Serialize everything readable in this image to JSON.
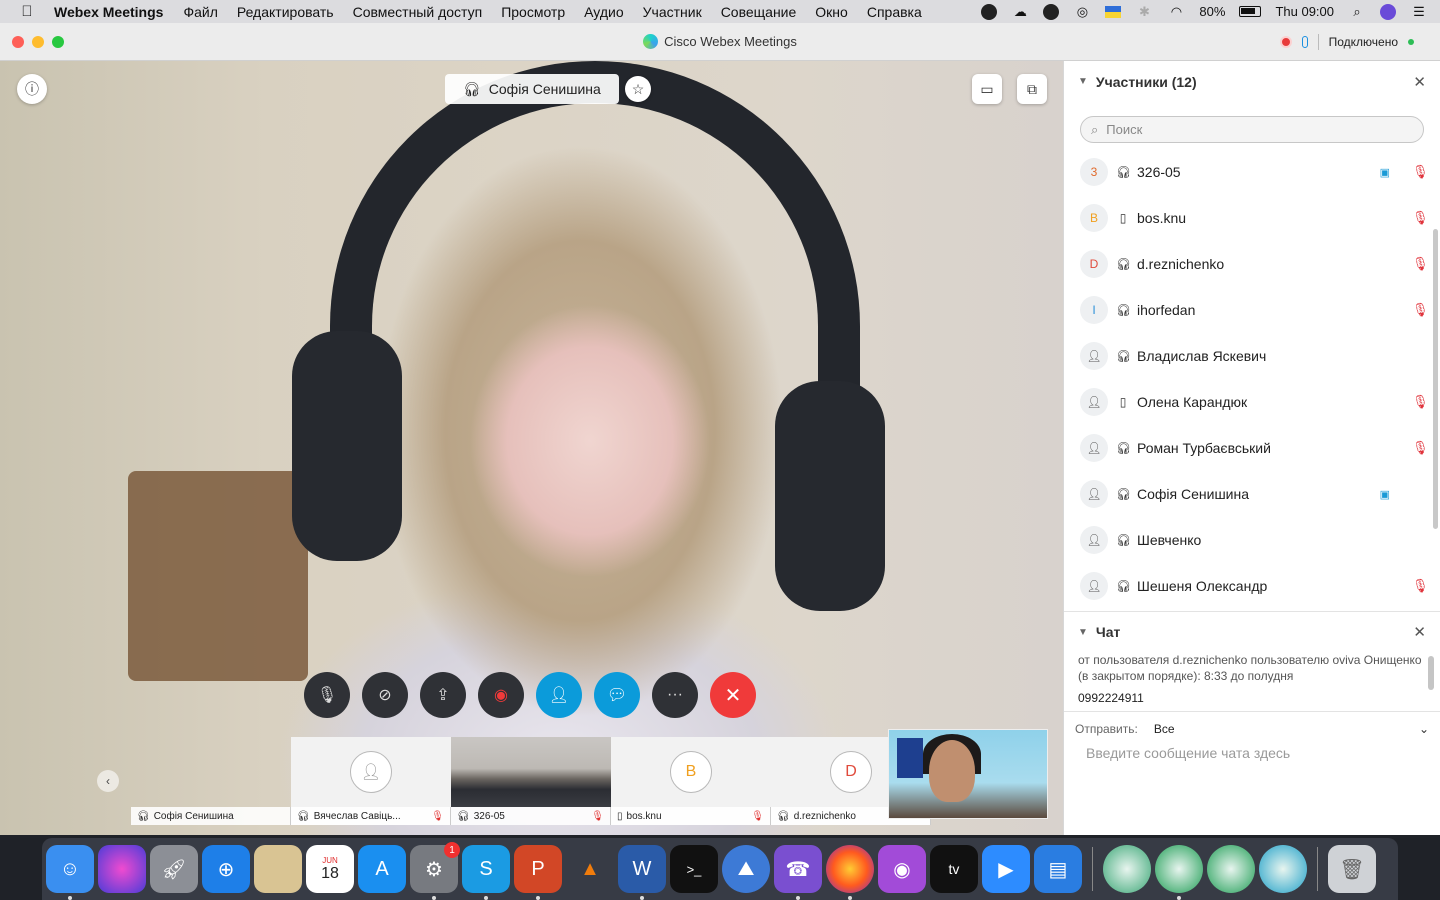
{
  "menubar": {
    "app_name": "Webex Meetings",
    "items": [
      "Файл",
      "Редактировать",
      "Совместный доступ",
      "Просмотр",
      "Аудио",
      "Участник",
      "Совещание",
      "Окно",
      "Справка"
    ],
    "battery": "80%",
    "clock": "Thu 09:00"
  },
  "window": {
    "title": "Cisco Webex Meetings",
    "status": "Подключено"
  },
  "stage": {
    "active_speaker": "Софія Сенишина"
  },
  "thumbnails": [
    {
      "name": "Софія Сенишина",
      "type": "video-live",
      "muted": false
    },
    {
      "name": "Вячеслав Савіць...",
      "type": "avatar",
      "initial": "",
      "muted": true
    },
    {
      "name": "326-05",
      "type": "video-room",
      "muted": true
    },
    {
      "name": "bos.knu",
      "type": "avatar",
      "initial": "B",
      "muted": true
    },
    {
      "name": "d.reznichenko",
      "type": "avatar",
      "initial": "D",
      "muted": false
    }
  ],
  "participants": {
    "header": "Участники (12)",
    "search_placeholder": "Поиск",
    "list": [
      {
        "initial": "3",
        "initial_color": "#e06a2c",
        "audio": "headset",
        "name": "326-05",
        "video": true,
        "muted": true
      },
      {
        "initial": "B",
        "initial_color": "#f0a020",
        "audio": "phone",
        "name": "bos.knu",
        "video": false,
        "muted": true
      },
      {
        "initial": "D",
        "initial_color": "#e04b3c",
        "audio": "headset",
        "name": "d.reznichenko",
        "video": false,
        "muted": true
      },
      {
        "initial": "I",
        "initial_color": "#2b8fd8",
        "audio": "headset",
        "name": "ihorfedan",
        "video": false,
        "muted": true
      },
      {
        "initial": "",
        "initial_color": "#555555",
        "audio": "headset",
        "name": "Владислав Яскевич",
        "video": false,
        "muted": false
      },
      {
        "initial": "",
        "initial_color": "#555555",
        "audio": "phone",
        "name": "Олена Карандюк",
        "video": false,
        "muted": true
      },
      {
        "initial": "",
        "initial_color": "#555555",
        "audio": "headset",
        "name": "Роман Турбаєвський",
        "video": false,
        "muted": true
      },
      {
        "initial": "",
        "initial_color": "#555555",
        "audio": "headset",
        "name": "Софія Сенишина",
        "video": true,
        "muted": false
      },
      {
        "initial": "",
        "initial_color": "#555555",
        "audio": "headset",
        "name": "Шевченко",
        "video": false,
        "muted": false
      },
      {
        "initial": "",
        "initial_color": "#555555",
        "audio": "headset",
        "name": "Шешеня Олександр",
        "video": false,
        "muted": true
      }
    ]
  },
  "chat": {
    "header": "Чат",
    "message_meta": "от пользователя d.reznichenko пользователю oviva Онищенко (в закрытом порядке):   8:33  до полудня",
    "message_text": "0992224911",
    "send_label": "Отправить:",
    "send_to": "Все",
    "input_placeholder": "Введите сообщение чата здесь"
  },
  "dock": {
    "calendar_month": "JUN",
    "calendar_day": "18",
    "settings_badge": "1"
  },
  "colors": {
    "accent_blue": "#0b9bda",
    "end_call_red": "#f03a3a",
    "mute_red": "#e0323a",
    "connected_green": "#2dbd55"
  }
}
